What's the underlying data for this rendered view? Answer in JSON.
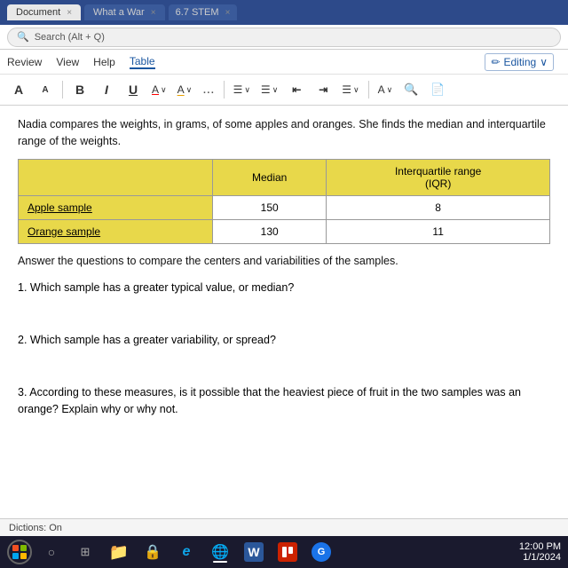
{
  "browser": {
    "tabs": [
      {
        "label": "Document",
        "active": true,
        "close": "×"
      },
      {
        "label": "What a War",
        "active": false,
        "close": "×"
      },
      {
        "label": "6.7 STEM",
        "active": false,
        "close": "×"
      }
    ],
    "address": "Search (Alt + Q)",
    "url": "sw/r/personal/pm10214_cherokeek12_net/_layouts/15/doc.aspx?sourcedoc=%7Bd427a7b6-40b0-451a-9a14-bd84d3..."
  },
  "ribbon": {
    "menu_items": [
      "Review",
      "View",
      "Help",
      "Table"
    ],
    "editing_label": "Editing",
    "toolbar": {
      "font_size_btn": "A",
      "font_size_small": "A",
      "bold": "B",
      "italic": "I",
      "underline": "U",
      "color": "A",
      "highlight": "A",
      "ellipsis": "...",
      "list1": "≡",
      "list2": "≡",
      "indent1": "⇤",
      "indent2": "⇥",
      "align": "≡",
      "font_color_btn": "A",
      "find_btn": "🔍"
    }
  },
  "document": {
    "intro_text": "Nadia compares the weights, in grams, of some apples and oranges. She finds the median and interquartile range of the weights.",
    "table": {
      "headers": [
        "",
        "Median",
        "Interquartile range\n(IQR)"
      ],
      "rows": [
        {
          "label": "Apple sample",
          "median": "150",
          "iqr": "8"
        },
        {
          "label": "Orange sample",
          "median": "130",
          "iqr": "11"
        }
      ]
    },
    "answer_prompt": "Answer the questions to compare the centers and variabilities of the samples.",
    "questions": [
      {
        "number": "1.",
        "text": "Which sample has a greater typical value, or median?"
      },
      {
        "number": "2.",
        "text": "Which sample has a greater variability, or spread?"
      },
      {
        "number": "3.",
        "text": "According to these measures, is it possible that the heaviest piece of fruit in the two samples was an orange? Explain why or why not."
      }
    ]
  },
  "status": {
    "text": "Dictions: On"
  },
  "taskbar": {
    "start_label": "○",
    "apps": [
      {
        "name": "windows",
        "icon": "win"
      },
      {
        "name": "file-explorer",
        "icon": "📁"
      },
      {
        "name": "folder",
        "icon": "📂"
      },
      {
        "name": "lock",
        "icon": "🔒"
      },
      {
        "name": "edge",
        "icon": "e"
      },
      {
        "name": "chrome",
        "icon": "⊙"
      },
      {
        "name": "word",
        "icon": "W"
      },
      {
        "name": "red-app",
        "icon": "R"
      },
      {
        "name": "blue-app",
        "icon": "G"
      }
    ]
  }
}
